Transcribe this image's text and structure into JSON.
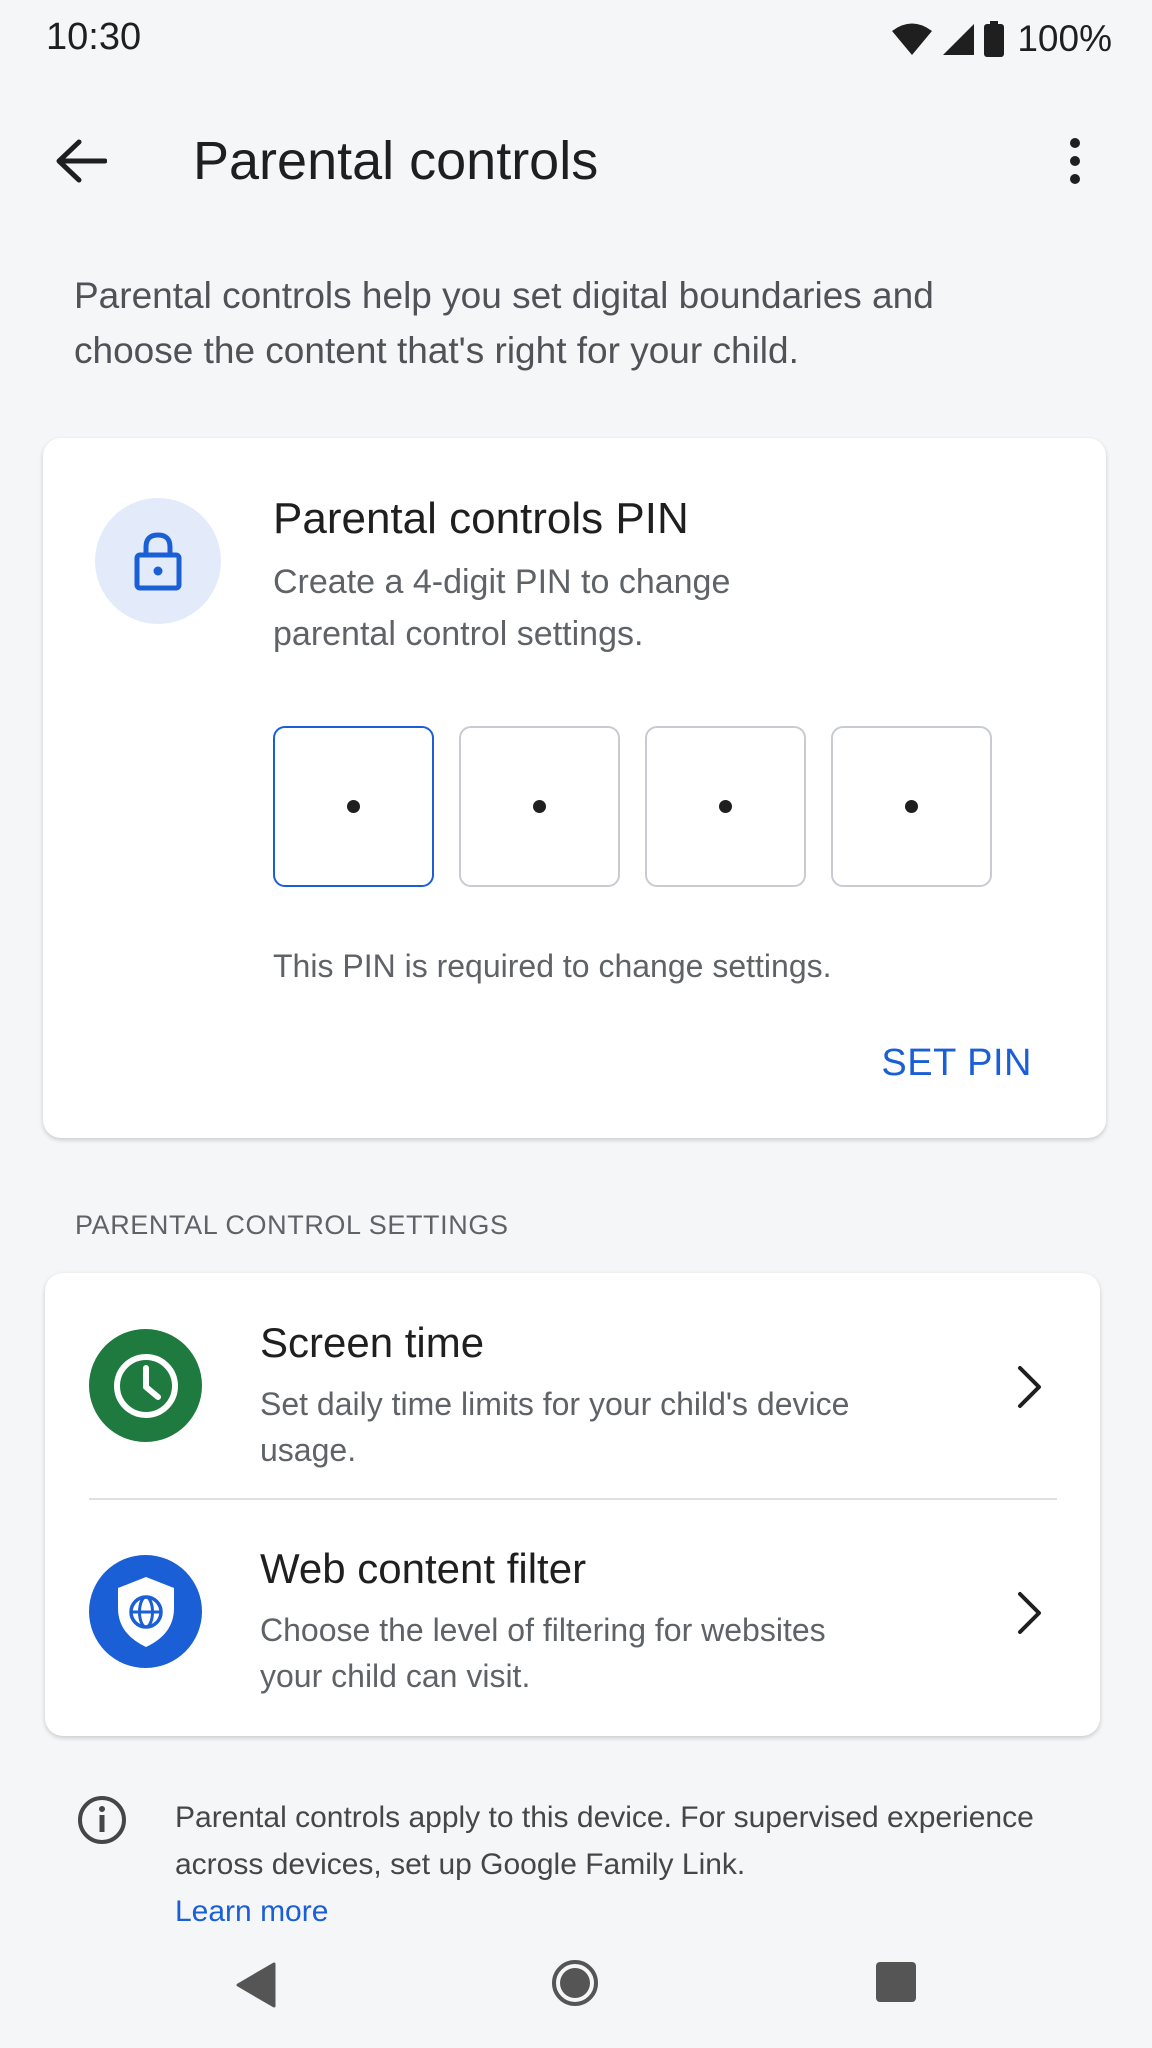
{
  "status_bar": {
    "time": "10:30",
    "battery": "100%"
  },
  "app_bar": {
    "title": "Parental controls"
  },
  "intro": "Parental controls help you set digital boundaries and choose the content that's right for your child.",
  "pin_card": {
    "title": "Parental controls PIN",
    "subtitle": "Create a 4-digit PIN to change parental control settings.",
    "note": "This PIN is required to change settings.",
    "action": "SET PIN"
  },
  "section_label": "PARENTAL CONTROL SETTINGS",
  "settings": [
    {
      "title": "Screen time",
      "description": "Set daily time limits for your child's device usage."
    },
    {
      "title": "Web content filter",
      "description": "Choose the level of filtering for websites your child can visit."
    }
  ],
  "footer": {
    "info": "Parental controls apply to this device. For supervised experience across devices, set up Google Family Link.",
    "link": "Learn more"
  },
  "colors": {
    "accent": "#1a5fd6",
    "screen_time": "#1e7a3e",
    "web_filter": "#1a5fd6"
  },
  "icons": [
    "wifi-icon",
    "signal-icon",
    "battery-icon",
    "back-arrow-icon",
    "more-vert-icon",
    "lock-icon",
    "clock-icon",
    "shield-globe-icon",
    "chevron-right-icon",
    "info-icon",
    "nav-back-icon",
    "nav-home-icon",
    "nav-recents-icon"
  ]
}
